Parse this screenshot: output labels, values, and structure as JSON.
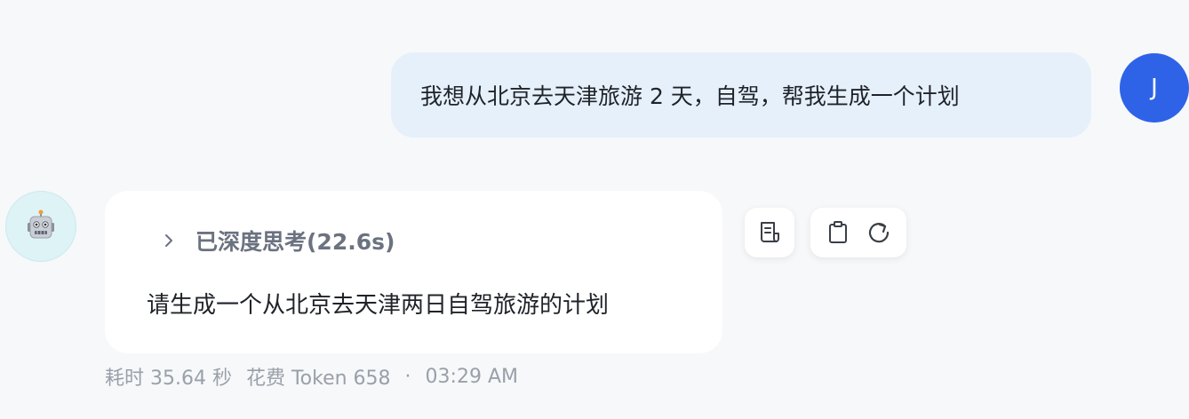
{
  "user_message": {
    "text": "我想从北京去天津旅游 2 天，自驾，帮我生成一个计划",
    "avatar_initial": "J",
    "avatar_color": "#2e63e8"
  },
  "bot_message": {
    "avatar_icon": "robot-icon",
    "thinking_label": "已深度思考(22.6s)",
    "text": "请生成一个从北京去天津两日自驾旅游的计划"
  },
  "actions": [
    {
      "icon": "document-icon"
    },
    {
      "icon": "clipboard-icon"
    },
    {
      "icon": "refresh-icon"
    }
  ],
  "meta": {
    "time_label": "耗时 35.64 秒",
    "token_label": "花费 Token 658",
    "separator": "·",
    "timestamp": "03:29 AM"
  },
  "colors": {
    "background": "#f7f8fa",
    "user_bubble": "#e6f0fb",
    "bot_bubble": "#ffffff"
  }
}
